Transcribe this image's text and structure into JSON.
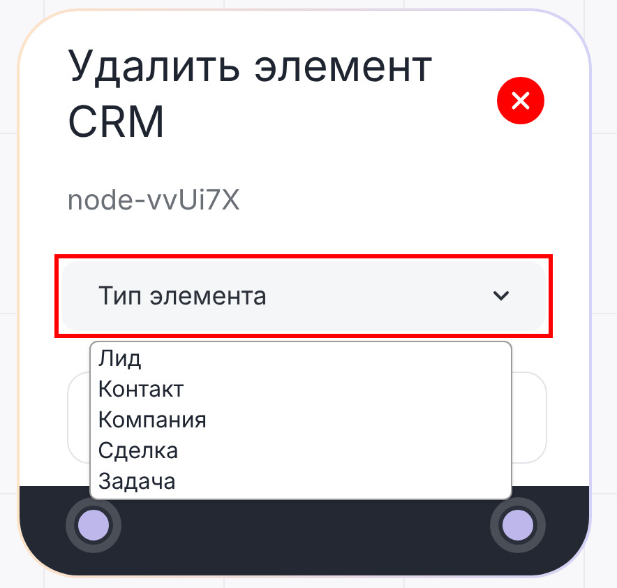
{
  "dialog": {
    "title": "Удалить элемент CRM",
    "subtitle": "node-vvUi7X"
  },
  "select": {
    "placeholder": "Тип элемента",
    "options": [
      "Лид",
      "Контакт",
      "Компания",
      "Сделка",
      "Задача"
    ]
  }
}
